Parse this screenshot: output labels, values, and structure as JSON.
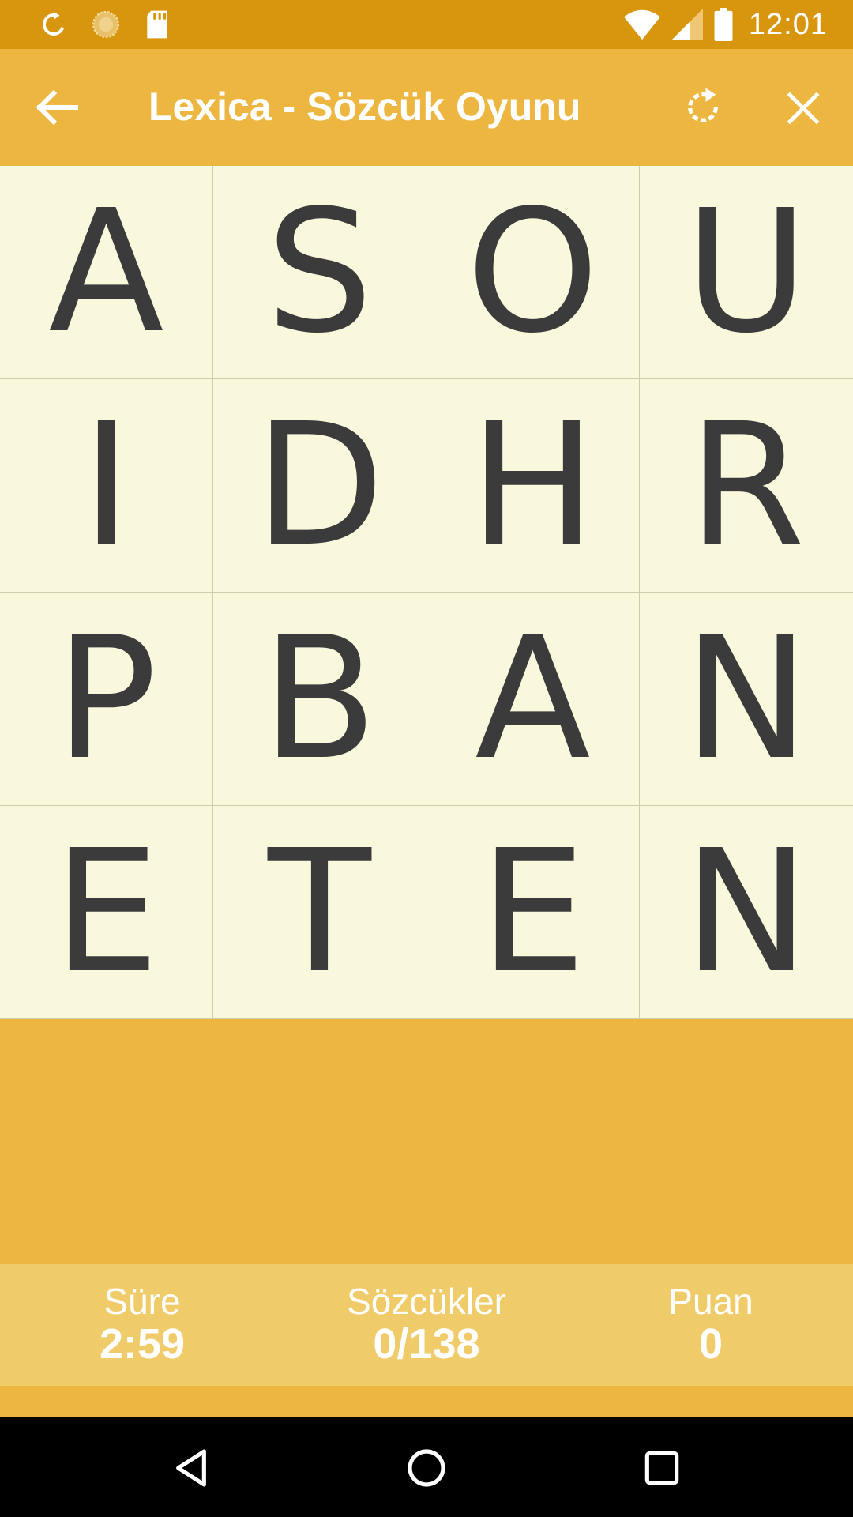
{
  "status_bar": {
    "time": "12:01",
    "icons": [
      "sync-icon",
      "sun-icon",
      "sd-card-icon",
      "wifi-icon",
      "signal-icon",
      "battery-icon"
    ]
  },
  "app_bar": {
    "title": "Lexica - Sözcük Oyunu",
    "icons": [
      "back-arrow-icon",
      "refresh-icon",
      "close-icon"
    ]
  },
  "board": {
    "rows": [
      [
        "A",
        "S",
        "O",
        "U"
      ],
      [
        "I",
        "D",
        "H",
        "R"
      ],
      [
        "P",
        "B",
        "A",
        "N"
      ],
      [
        "E",
        "T",
        "E",
        "N"
      ]
    ]
  },
  "stats": {
    "time_label": "Süre",
    "time_value": "2:59",
    "words_label": "Sözcükler",
    "words_value": "0/138",
    "score_label": "Puan",
    "score_value": "0"
  },
  "nav_bar": {
    "icons": [
      "back-triangle-icon",
      "home-circle-icon",
      "recents-square-icon"
    ]
  },
  "colors": {
    "status_bar": "#D8960F",
    "accent": "#EDB641",
    "board_bg": "#F9F8DC",
    "stats_bg": "#F0CB6A",
    "letter": "#3B3B3B"
  }
}
